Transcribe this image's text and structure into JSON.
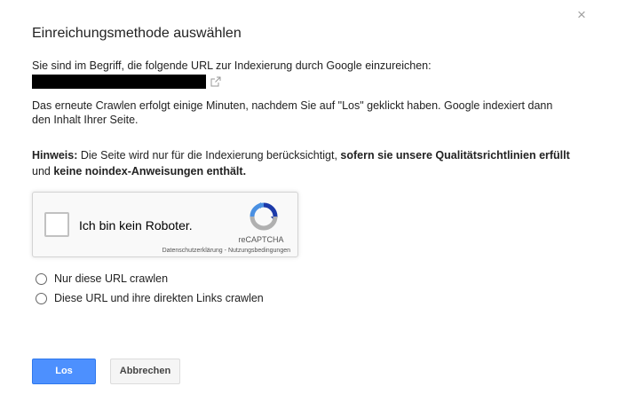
{
  "dialog": {
    "title": "Einreichungsmethode auswählen",
    "close_symbol": "×",
    "intro": "Sie sind im Begriff, die folgende URL zur Indexierung durch Google einzureichen:",
    "url_external_icon": "external-link-icon",
    "crawl_info": "Das erneute Crawlen erfolgt einige Minuten, nachdem Sie auf \"Los\" geklickt haben. Google indexiert dann den Inhalt Ihrer Seite.",
    "note": {
      "label": "Hinweis:",
      "text1": " Die Seite wird nur für die Indexierung berücksichtigt, ",
      "bold1": "sofern sie unsere Qualitätsrichtlinien erfüllt",
      "text2": " und ",
      "bold2": "keine noindex-Anweisungen enthält."
    }
  },
  "recaptcha": {
    "label": "Ich bin kein Roboter.",
    "brand": "reCAPTCHA",
    "privacy": "Datenschutzerklärung",
    "separator": " - ",
    "terms": "Nutzungsbedingungen",
    "colors": {
      "blue": "#1c3aa9",
      "light_blue": "#4a90e2",
      "gray": "#b0b0b0"
    }
  },
  "options": [
    {
      "label": "Nur diese URL crawlen",
      "selected": false
    },
    {
      "label": "Diese URL und ihre direkten Links crawlen",
      "selected": false
    }
  ],
  "buttons": {
    "submit": "Los",
    "cancel": "Abbrechen"
  },
  "colors": {
    "primary": "#4d90fe",
    "primary_border": "#3079ed",
    "secondary_bg": "#f5f5f5"
  }
}
